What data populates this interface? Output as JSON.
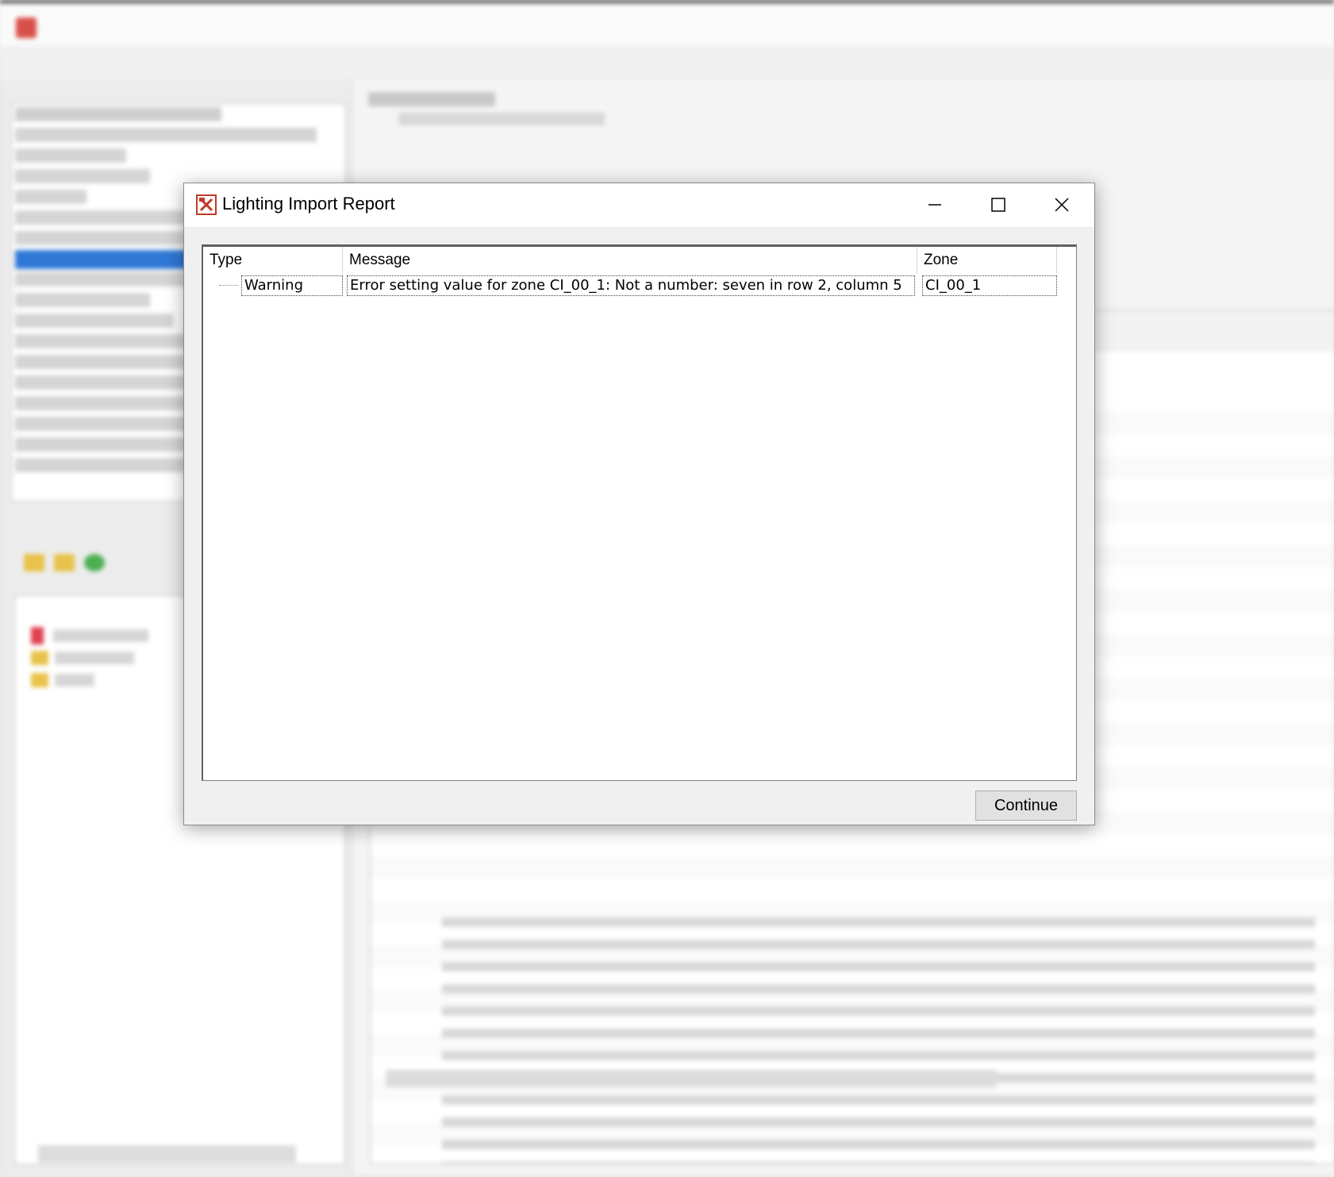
{
  "dialog": {
    "title": "Lighting Import Report",
    "columns": [
      "Type",
      "Message",
      "Zone"
    ],
    "rows": [
      {
        "type": "Warning",
        "message": "Error setting value for zone CI_00_1: Not a number:  seven in row 2, column 5",
        "zone": "CI_00_1"
      }
    ],
    "continue_label": "Continue",
    "icons": {
      "app": "app-tools-icon",
      "minimize": "minimize-icon",
      "maximize": "maximize-icon",
      "close": "close-icon"
    },
    "colors": {
      "icon_red": "#c0392b",
      "button_bg": "#e1e1e1"
    }
  }
}
